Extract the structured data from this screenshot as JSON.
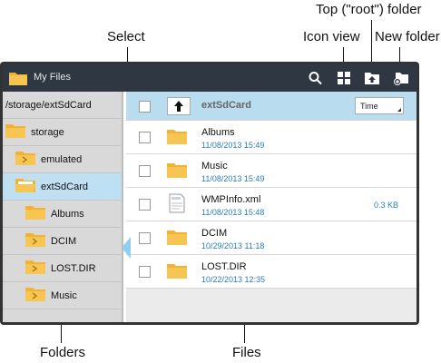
{
  "callouts": {
    "top_folder": "Top (\"root\") folder",
    "select": "Select",
    "icon_view": "Icon view",
    "new_folder": "New folder",
    "folders": "Folders",
    "files": "Files"
  },
  "actionbar": {
    "title": "My Files",
    "icons": [
      "search-icon",
      "grid-view-icon",
      "top-folder-icon",
      "new-folder-icon"
    ]
  },
  "sidebar": {
    "path": "/storage/extSdCard",
    "items": [
      {
        "label": "storage"
      },
      {
        "label": "emulated"
      },
      {
        "label": "extSdCard",
        "selected": true
      },
      {
        "label": "Albums"
      },
      {
        "label": "DCIM"
      },
      {
        "label": "LOST.DIR"
      },
      {
        "label": "Music"
      }
    ]
  },
  "list": {
    "header": {
      "name": "extSdCard",
      "sort_label": "Time"
    },
    "rows": [
      {
        "name": "Albums",
        "date": "11/08/2013 15:49",
        "size": ""
      },
      {
        "name": "Music",
        "date": "11/08/2013 15:49",
        "size": ""
      },
      {
        "name": "WMPInfo.xml",
        "date": "11/08/2013 15:48",
        "size": "0.3 KB"
      },
      {
        "name": "DCIM",
        "date": "10/29/2013 11:18",
        "size": ""
      },
      {
        "name": "LOST.DIR",
        "date": "10/22/2013 12:35",
        "size": ""
      }
    ]
  },
  "colors": {
    "actionbar": "#2f3742",
    "folder": "#f2b233",
    "selection": "#bfe0f3",
    "accent_text": "#2a7db8"
  }
}
